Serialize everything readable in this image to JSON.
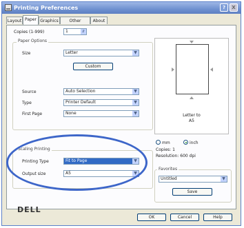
{
  "window": {
    "title": "Printing Preferences",
    "help_label": "?",
    "close_label": "X"
  },
  "tabs": [
    {
      "label": "Layout"
    },
    {
      "label": "Paper"
    },
    {
      "label": "Graphics"
    },
    {
      "label": "Other Options"
    },
    {
      "label": "About"
    }
  ],
  "copies": {
    "label": "Copies (1-999)",
    "value": "1"
  },
  "paper_options": {
    "title": "Paper Options",
    "size_label": "Size",
    "size_value": "Letter",
    "custom_label": "Custom",
    "source_label": "Source",
    "source_value": "Auto Selection",
    "type_label": "Type",
    "type_value": "Printer Default",
    "first_page_label": "First Page",
    "first_page_value": "None"
  },
  "scaling": {
    "title": "Scaling Printing",
    "printing_type_label": "Printing Type",
    "printing_type_value": "Fit to Page",
    "output_size_label": "Output size",
    "output_size_value": "A5"
  },
  "preview": {
    "caption_line1": "Letter to",
    "caption_line2": "A5",
    "unit_mm": "mm",
    "unit_inch": "inch",
    "selected_unit": "inch",
    "copies_text": "Copies: 1",
    "resolution_text": "Resolution: 600 dpi"
  },
  "favorites": {
    "title": "Favorites",
    "value": "Untitled",
    "save_label": "Save"
  },
  "brand": {
    "logo_text": "DELL"
  },
  "footer": {
    "ok_label": "OK",
    "cancel_label": "Cancel",
    "help_label": "Help"
  },
  "icons": {
    "dropdown": "chevron-down-icon",
    "spinner": "spinner-arrows-icon"
  },
  "colors": {
    "titlebar": "#6f91d0",
    "highlight_ellipse": "#3d66c9",
    "selected_option": "#316ac5"
  }
}
